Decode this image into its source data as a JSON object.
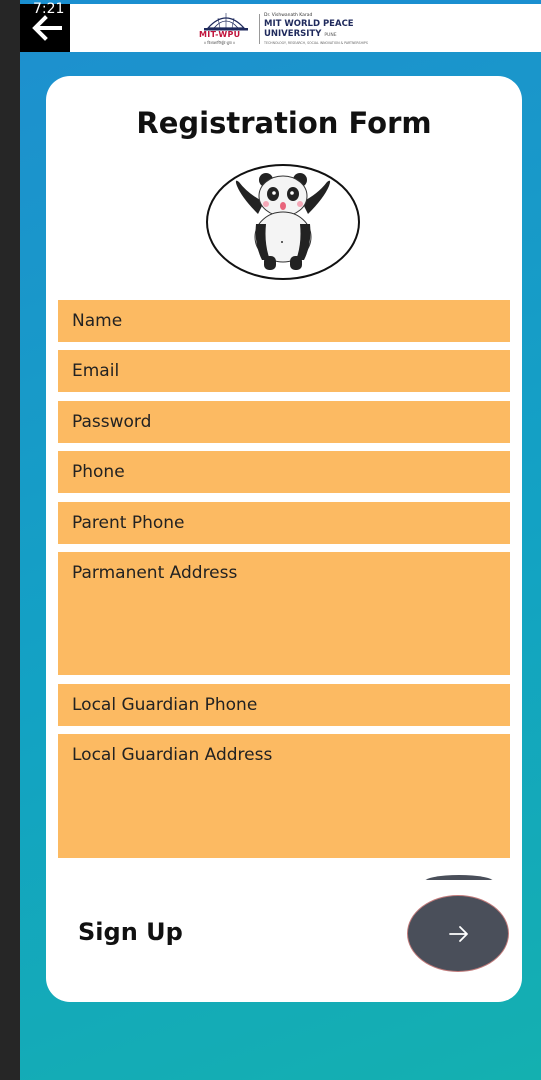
{
  "status": {
    "time": "7:21"
  },
  "header": {
    "back_icon": "arrow-left-icon",
    "logo": {
      "brand_short": "MIT-WPU",
      "tagline": "॥ विश्वशान्तिर्ध्रुवं ध्रुवा ॥",
      "founder_line": "Dr. Vishwanath Karad",
      "university_line1": "MIT WORLD PEACE",
      "university_line2": "UNIVERSITY",
      "city": "PUNE",
      "motto": "TECHNOLOGY, RESEARCH, SOCIAL INNOVATION & PARTNERSHIPS"
    }
  },
  "form": {
    "title": "Registration Form",
    "avatar_icon": "panda-icon",
    "fields": {
      "name": "Name",
      "email": "Email",
      "password": "Password",
      "phone": "Phone",
      "parent_phone": "Parent Phone",
      "permanent_address": "Parmanent Address",
      "local_guardian_phone": "Local Guardian Phone",
      "local_guardian_address": "Local Guardian Address"
    },
    "signup_label": "Sign Up",
    "signup_button_icon": "arrow-right-icon"
  },
  "colors": {
    "field_bg": "#fcba62",
    "button_bg": "#4a4f5a",
    "gradient_start": "#1e8fcf",
    "gradient_end": "#14b0b0"
  }
}
